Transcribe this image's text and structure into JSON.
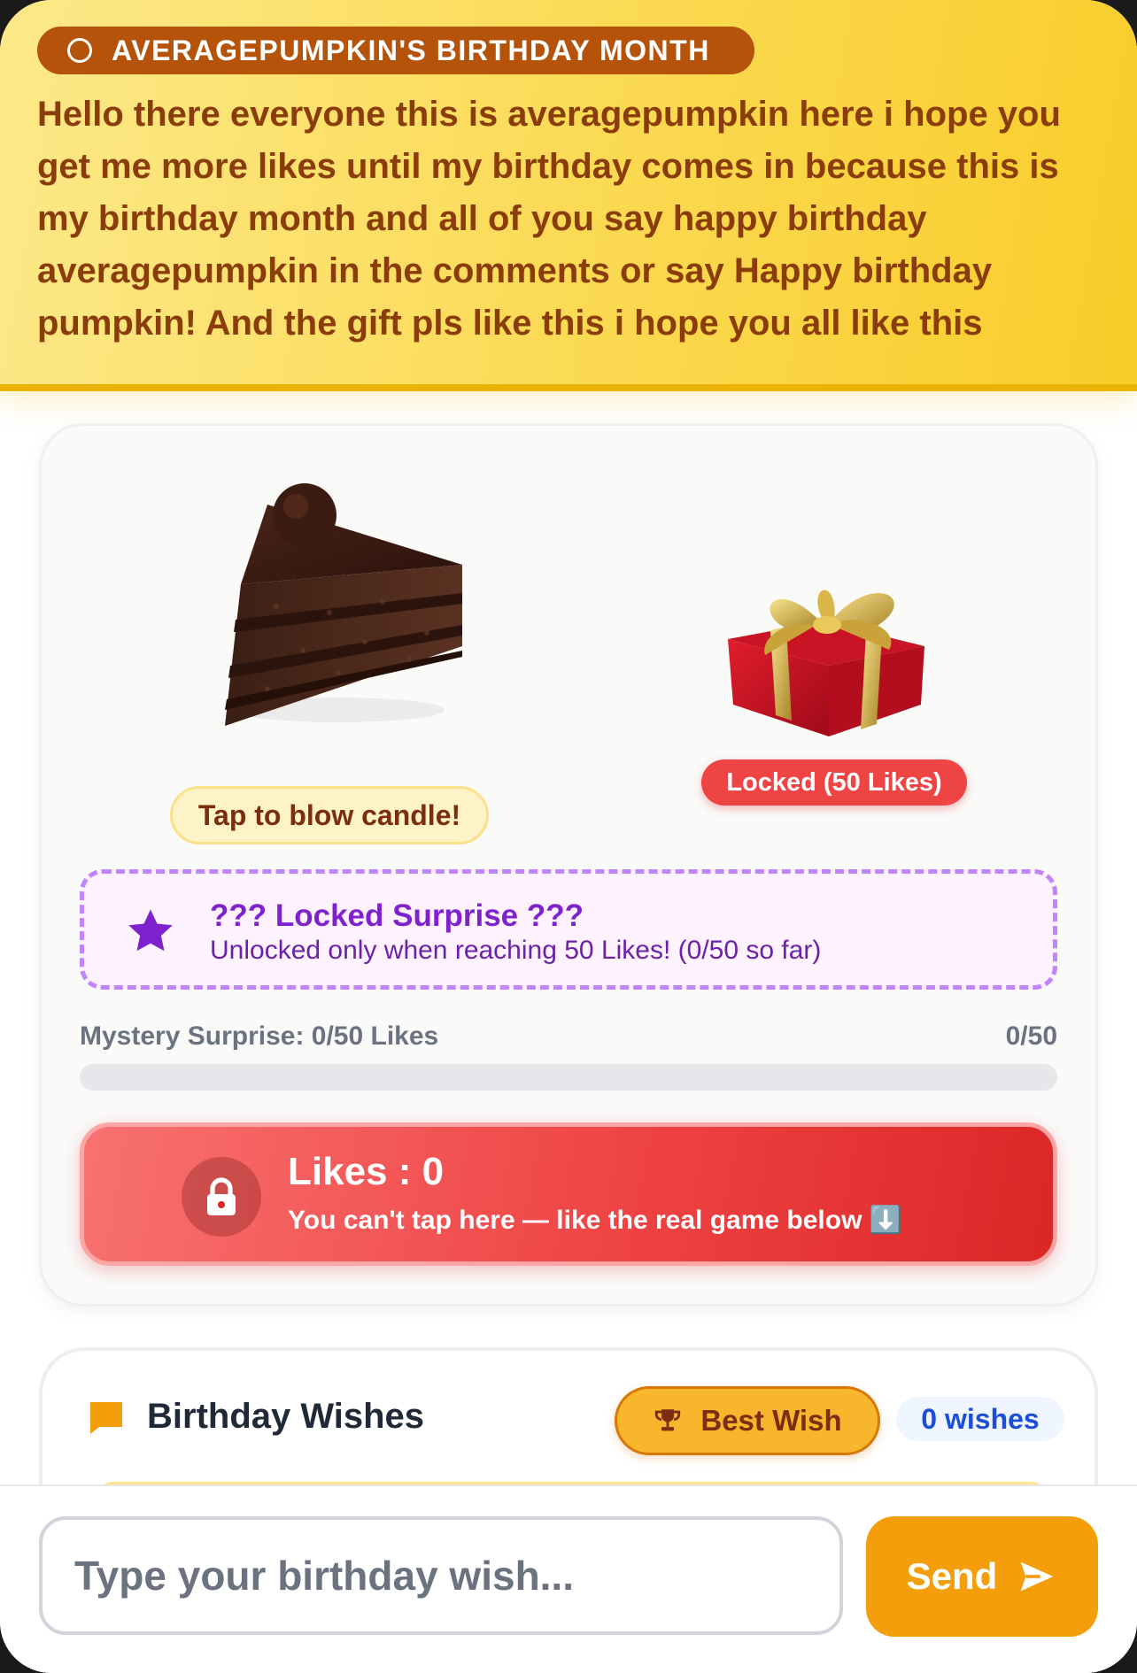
{
  "header": {
    "badge": "AVERAGEPUMPKIN'S BIRTHDAY MONTH",
    "message": "Hello there everyone this is averagepumpkin here i hope you get me more likes until my birthday comes in because this is my birthday month and all of you say happy birthday averagepumpkin in the comments or say Happy birthday pumpkin! And the gift pls like this i hope you all like this"
  },
  "cake": {
    "icon": "cake-slice-image",
    "badge": "Tap to blow candle!"
  },
  "gift": {
    "icon": "gift-box-image",
    "badge": "Locked (50 Likes)"
  },
  "surprise": {
    "icon": "star-icon",
    "title": "??? Locked Surprise ???",
    "subtitle": "Unlocked only when reaching 50 Likes! (0/50 so far)"
  },
  "progress": {
    "label": "Mystery Surprise: 0/50 Likes",
    "count": "0/50",
    "value": 0,
    "max": 50
  },
  "likes_button": {
    "icon": "lock-icon",
    "title": "Likes :  0",
    "subtitle": "You can't tap here — like the real game below ⬇️"
  },
  "wishes": {
    "icon": "chat-bubble-icon",
    "title": "Birthday Wishes",
    "best_label": "Best Wish",
    "best_icon": "trophy-icon",
    "count": "0 wishes"
  },
  "composer": {
    "placeholder": "Type your birthday wish...",
    "value": "",
    "send_label": "Send",
    "send_icon": "send-arrow-icon"
  },
  "colors": {
    "header_bg": "#fbd951",
    "accent_orange": "#f59e0b",
    "likes_red": "#ef4444",
    "surprise_purple": "#7e22ce"
  }
}
